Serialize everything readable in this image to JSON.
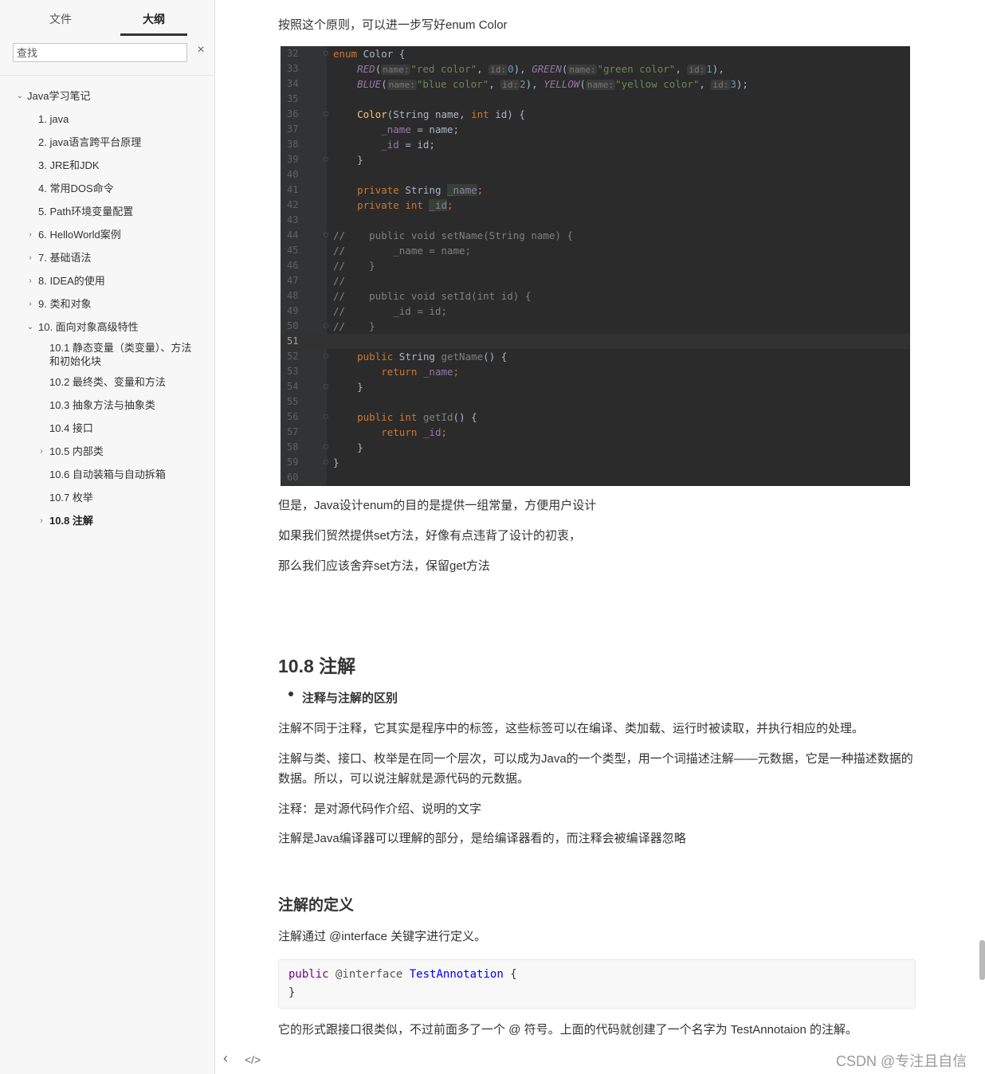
{
  "sidebar": {
    "tabs": [
      "文件",
      "大纲"
    ],
    "search_placeholder": "查找",
    "clear_icon": "×",
    "toc": [
      {
        "label": "Java学习笔记"
      },
      {
        "label": "1. java"
      },
      {
        "label": "2. java语言跨平台原理"
      },
      {
        "label": "3. JRE和JDK"
      },
      {
        "label": "4. 常用DOS命令"
      },
      {
        "label": "5. Path环境变量配置"
      },
      {
        "label": "6. HelloWorld案例"
      },
      {
        "label": "7. 基础语法"
      },
      {
        "label": "8. IDEA的使用"
      },
      {
        "label": "9. 类和对象"
      },
      {
        "label": "10. 面向对象高级特性"
      },
      {
        "label": "10.1 静态变量（类变量）、方法和初始化块"
      },
      {
        "label": "10.2 最终类、变量和方法"
      },
      {
        "label": "10.3 抽象方法与抽象类"
      },
      {
        "label": "10.4 接口"
      },
      {
        "label": "10.5 内部类"
      },
      {
        "label": "10.6 自动装箱与自动拆箱"
      },
      {
        "label": "10.7 枚举"
      },
      {
        "label": "10.8 注解"
      }
    ]
  },
  "content": {
    "p_intro": "按照这个原则，可以进一步写好enum Color",
    "p_after1": "但是，Java设计enum的目的是提供一组常量，方便用户设计",
    "p_after2": "如果我们贸然提供set方法，好像有点违背了设计的初衷，",
    "p_after3": "那么我们应该舍弃set方法，保留get方法",
    "h2": "10.8 注解",
    "bullet": "注释与注解的区别",
    "p1": "注解不同于注释，它其实是程序中的标签，这些标签可以在编译、类加载、运行时被读取，并执行相应的处理。",
    "p2": "注解与类、接口、枚举是在同一个层次，可以成为Java的一个类型，用一个词描述注解——元数据，它是一种描述数据的数据。所以，可以说注解就是源代码的元数据。",
    "p3": "注释：是对源代码作介绍、说明的文字",
    "p4": "注解是Java编译器可以理解的部分，是给编译器看的，而注释会被编译器忽略",
    "h3": "注解的定义",
    "p5": "注解通过 @interface 关键字进行定义。",
    "code_kw": "public",
    "code_at": "@interface",
    "code_name": "TestAnnotation",
    "code_brace_open": "{",
    "code_brace_close": "}",
    "p6": "它的形式跟接口很类似，不过前面多了一个 @ 符号。上面的代码就创建了一个名字为 TestAnnotaion 的注解。"
  },
  "code_lines": {
    "nums": [
      "32",
      "33",
      "34",
      "35",
      "36",
      "37",
      "38",
      "39",
      "40",
      "41",
      "42",
      "43",
      "44",
      "45",
      "46",
      "47",
      "48",
      "49",
      "50",
      "51",
      "52",
      "53",
      "54",
      "55",
      "56",
      "57",
      "58",
      "59",
      "60"
    ],
    "l32": [
      "enum",
      " Color {"
    ],
    "l33": [
      "RED",
      "(",
      "name:",
      "\"red color\"",
      ", ",
      "id:",
      "0",
      "), ",
      "GREEN",
      "(",
      "name:",
      "\"green color\"",
      ", ",
      "id:",
      "1",
      "),"
    ],
    "l34": [
      "BLUE",
      "(",
      "name:",
      "\"blue color\"",
      ", ",
      "id:",
      "2",
      "), ",
      "YELLOW",
      "(",
      "name:",
      "\"yellow color\"",
      ", ",
      "id:",
      "3",
      ");"
    ],
    "l36": [
      "Color",
      "(String name, ",
      "int",
      " id) {"
    ],
    "l37": [
      "_name",
      " = name;"
    ],
    "l38": [
      "_id",
      " = id;"
    ],
    "l39": "}",
    "l41": [
      "private",
      " String ",
      "_name",
      ";"
    ],
    "l42": [
      "private",
      " ",
      "int",
      " ",
      "_id",
      ";"
    ],
    "l44": "//    public void setName(String name) {",
    "l45": "//        _name = name;",
    "l46": "//    }",
    "l47": "//",
    "l48": "//    public void setId(int id) {",
    "l49": "//        _id = id;",
    "l50": "//    }",
    "l52": [
      "public",
      " String ",
      "getName",
      "() {"
    ],
    "l53": [
      "return",
      " ",
      "_name",
      ";"
    ],
    "l54": "}",
    "l56": [
      "public",
      " ",
      "int",
      " ",
      "getId",
      "() {"
    ],
    "l57": [
      "return",
      " ",
      "_id",
      ";"
    ],
    "l58": "}",
    "l59": "}"
  },
  "footer": {
    "chevron_left": "‹",
    "source_toggle": "</>"
  },
  "watermark": "CSDN @专注且自信"
}
